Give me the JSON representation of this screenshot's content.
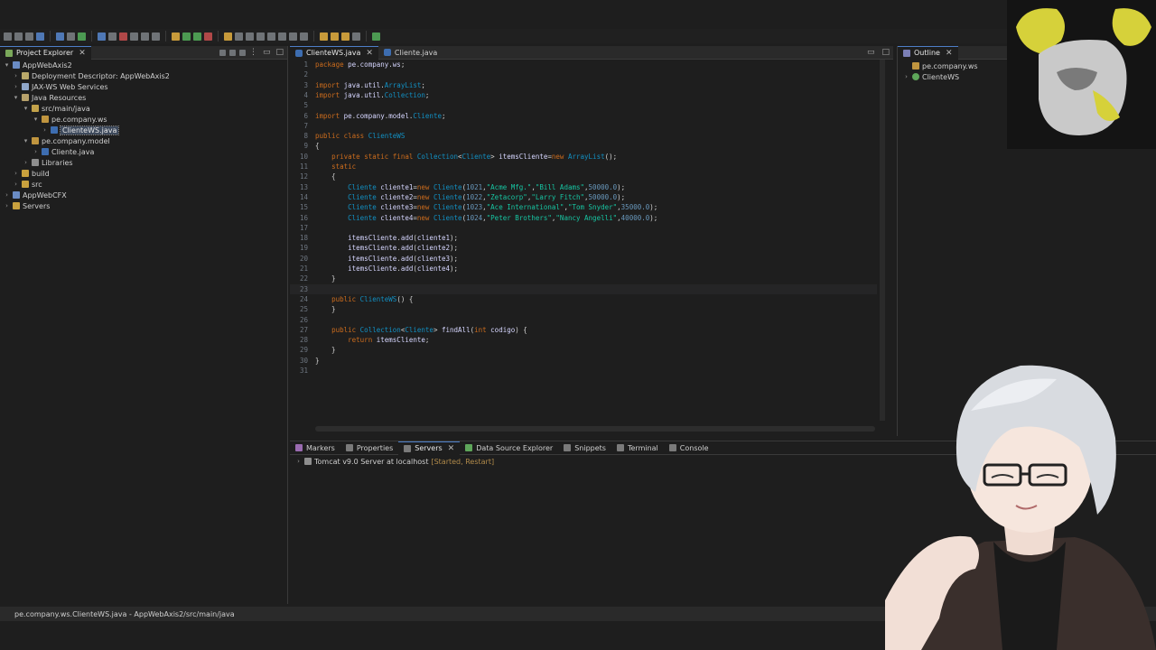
{
  "toolbar": {
    "icons": [
      "new-icon",
      "save-icon",
      "print-icon",
      "open-icon",
      "refresh-icon",
      "search-icon",
      "debug-icon",
      "run-icon",
      "stop-icon",
      "resume-icon",
      "step-icon",
      "back-icon",
      "forward-icon",
      "perspective-icon"
    ]
  },
  "explorer": {
    "title": "Project Explorer",
    "tree": [
      {
        "label": "AppWebAxis2",
        "icon": "project-icon"
      },
      {
        "label": "Deployment Descriptor: AppWebAxis2",
        "icon": "descriptor-icon"
      },
      {
        "label": "JAX-WS Web Services",
        "icon": "webservices-icon"
      },
      {
        "label": "Java Resources",
        "icon": "java-resources-icon"
      },
      {
        "label": "src/main/java",
        "icon": "source-folder-icon"
      },
      {
        "label": "pe.company.ws",
        "icon": "package-icon"
      },
      {
        "label": "ClienteWS.java",
        "icon": "java-file-icon"
      },
      {
        "label": "pe.company.model",
        "icon": "package-icon"
      },
      {
        "label": "Cliente.java",
        "icon": "java-file-icon"
      },
      {
        "label": "Libraries",
        "icon": "libraries-icon"
      },
      {
        "label": "build",
        "icon": "folder-icon"
      },
      {
        "label": "src",
        "icon": "folder-icon"
      },
      {
        "label": "AppWebCFX",
        "icon": "project-icon"
      },
      {
        "label": "Servers",
        "icon": "folder-icon"
      }
    ]
  },
  "editor": {
    "tabs": [
      {
        "label": "ClienteWS.java",
        "active": true
      },
      {
        "label": "Cliente.java",
        "active": false
      }
    ],
    "code": [
      "package pe.company.ws;",
      "",
      "import java.util.ArrayList;",
      "import java.util.Collection;",
      "",
      "import pe.company.model.Cliente;",
      "",
      "public class ClienteWS",
      "{",
      "    private static final Collection<Cliente> itemsCliente=new ArrayList();",
      "    static",
      "    {",
      "        Cliente cliente1=new Cliente(1021,\"Acme Mfg.\",\"Bill Adams\",50000.0);",
      "        Cliente cliente2=new Cliente(1022,\"Zetacorp\",\"Larry Fitch\",50000.0);",
      "        Cliente cliente3=new Cliente(1023,\"Ace International\",\"Tom Snyder\",35000.0);",
      "        Cliente cliente4=new Cliente(1024,\"Peter Brothers\",\"Nancy Angelli\",40000.0);",
      "",
      "        itemsCliente.add(cliente1);",
      "        itemsCliente.add(cliente2);",
      "        itemsCliente.add(cliente3);",
      "        itemsCliente.add(cliente4);",
      "    }",
      "",
      "    public ClienteWS() {",
      "    }",
      "",
      "    public Collection<Cliente> findAll(int codigo) {",
      "        return itemsCliente;",
      "    }",
      "}",
      ""
    ],
    "current_line": 23
  },
  "outline": {
    "title": "Outline",
    "items": [
      {
        "label": "pe.company.ws",
        "icon": "package-icon"
      },
      {
        "label": "ClienteWS",
        "icon": "class-icon"
      }
    ]
  },
  "bottom": {
    "tabs": [
      {
        "label": "Markers",
        "icon": "markers-icon"
      },
      {
        "label": "Properties",
        "icon": "properties-icon"
      },
      {
        "label": "Servers",
        "icon": "servers-icon",
        "active": true
      },
      {
        "label": "Data Source Explorer",
        "icon": "datasource-icon"
      },
      {
        "label": "Snippets",
        "icon": "snippets-icon"
      },
      {
        "label": "Terminal",
        "icon": "terminal-icon"
      },
      {
        "label": "Console",
        "icon": "console-icon"
      }
    ],
    "server": {
      "name": "Tomcat v9.0 Server at localhost",
      "status": "[Started, Restart]"
    }
  },
  "status": {
    "text": "pe.company.ws.ClienteWS.java - AppWebAxis2/src/main/java"
  },
  "colors": {
    "background": "#1e1e1e",
    "tab_accent": "#4d7ec8",
    "keyword": "#cc6c1d",
    "type": "#1290c3",
    "string": "#17c6a3"
  }
}
